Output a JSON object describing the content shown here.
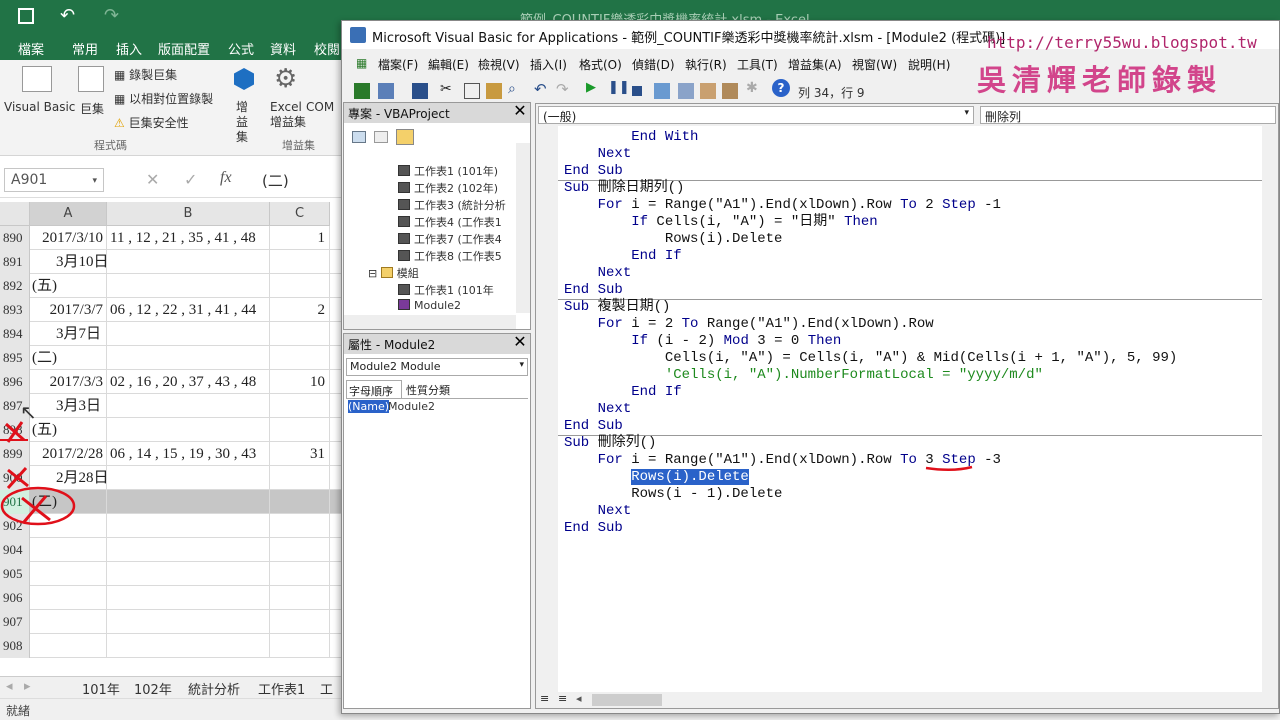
{
  "excel": {
    "title": "範例_COUNTIF樂透彩中獎機率統計.xlsm - Excel",
    "tabs": [
      "檔案",
      "常用",
      "插入",
      "版面配置",
      "公式",
      "資料",
      "校閱"
    ],
    "ribbon": {
      "visual_basic": "Visual Basic",
      "macros": "巨集",
      "record_macro": "錄製巨集",
      "relative_ref": "以相對位置錄製",
      "macro_security": "巨集安全性",
      "group_code": "程式碼",
      "addins": "增益集",
      "excel_addins": "Excel 增益集",
      "com": "COM",
      "group_addins": "增益集"
    },
    "name_box": "A901",
    "formula_value": "(二)",
    "columns": [
      "A",
      "B",
      "C"
    ],
    "rows": [
      {
        "n": "890",
        "a": "2017/3/10",
        "b": "11 , 12 , 21 , 35 , 41 , 48",
        "c": "1"
      },
      {
        "n": "891",
        "a": "3月10日",
        "b": "",
        "c": ""
      },
      {
        "n": "892",
        "a": "(五)",
        "b": "",
        "c": ""
      },
      {
        "n": "893",
        "a": "2017/3/7",
        "b": "06 , 12 , 22 , 31 , 41 , 44",
        "c": "2"
      },
      {
        "n": "894",
        "a": "3月7日",
        "b": "",
        "c": ""
      },
      {
        "n": "895",
        "a": "(二)",
        "b": "",
        "c": ""
      },
      {
        "n": "896",
        "a": "2017/3/3",
        "b": "02 , 16 , 20 , 37 , 43 , 48",
        "c": "10"
      },
      {
        "n": "897",
        "a": "3月3日",
        "b": "",
        "c": ""
      },
      {
        "n": "898",
        "a": "(五)",
        "b": "",
        "c": ""
      },
      {
        "n": "899",
        "a": "2017/2/28",
        "b": "06 , 14 , 15 , 19 , 30 , 43",
        "c": "31"
      },
      {
        "n": "900",
        "a": "2月28日",
        "b": "",
        "c": ""
      },
      {
        "n": "901",
        "a": "(二)",
        "b": "",
        "c": ""
      },
      {
        "n": "902",
        "a": "",
        "b": "",
        "c": ""
      },
      {
        "n": "904",
        "a": "",
        "b": "",
        "c": ""
      },
      {
        "n": "905",
        "a": "",
        "b": "",
        "c": ""
      },
      {
        "n": "906",
        "a": "",
        "b": "",
        "c": ""
      },
      {
        "n": "907",
        "a": "",
        "b": "",
        "c": ""
      },
      {
        "n": "908",
        "a": "",
        "b": "",
        "c": ""
      }
    ],
    "sheets": [
      "101年",
      "102年",
      "統計分析",
      "工作表1",
      "工作"
    ],
    "status": "就緒"
  },
  "vbe": {
    "title": "Microsoft Visual Basic for Applications - 範例_COUNTIF樂透彩中獎機率統計.xlsm - [Module2 (程式碼)]",
    "menu": [
      "檔案(F)",
      "編輯(E)",
      "檢視(V)",
      "插入(I)",
      "格式(O)",
      "偵錯(D)",
      "執行(R)",
      "工具(T)",
      "增益集(A)",
      "視窗(W)",
      "說明(H)"
    ],
    "position": "列 34，行 9",
    "watermark_url": "http://terry55wu.blogspot.tw",
    "watermark_name": "吳清輝老師錄製",
    "project_title": "專案 - VBAProject",
    "tree": [
      "工作表1 (101年)",
      "工作表2 (102年)",
      "工作表3 (統計分析",
      "工作表4 (工作表1",
      "工作表7 (工作表4",
      "工作表8 (工作表5",
      "模組",
      "工作表1 (101年",
      "Module2"
    ],
    "props_title": "屬性 - Module2",
    "props_combo": "Module2 Module",
    "props_tabs": [
      "字母順序",
      "性質分類"
    ],
    "props_name_key": "(Name)",
    "props_name_val": "Module2",
    "combo_object": "(一般)",
    "combo_proc": "刪除列"
  },
  "colors": {
    "excel_green": "#217346",
    "code_keyword": "#00008b",
    "code_comment": "#1e8a1e",
    "watermark": "#d2458b"
  }
}
